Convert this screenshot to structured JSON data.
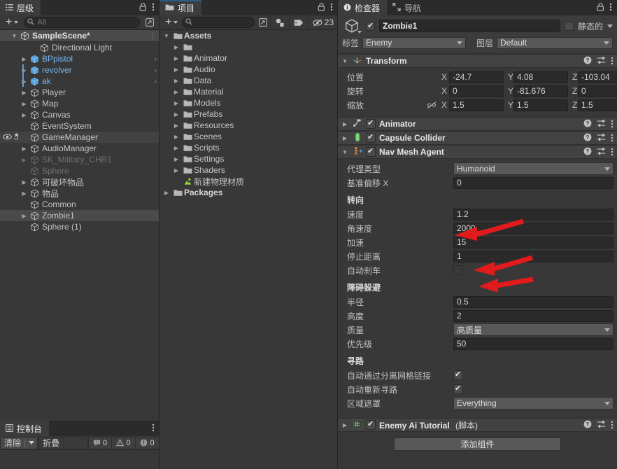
{
  "hierarchy": {
    "tab_label": "层级",
    "tab_icon": "hierarchy-icon",
    "search_placeholder": "All",
    "add_label": "+",
    "items": [
      {
        "label": "SampleScene*",
        "depth": 0,
        "icon": "scene-icon",
        "twisty": "▼",
        "selected": true,
        "kebab": true
      },
      {
        "label": "Directional Light",
        "depth": 2,
        "icon": "gameobject-icon",
        "twisty": ""
      },
      {
        "label": "BPpistol",
        "depth": 1,
        "icon": "prefab-icon",
        "twisty": "▶",
        "prefab": true,
        "chevron": "›"
      },
      {
        "label": "revolver",
        "depth": 1,
        "icon": "prefab-icon",
        "twisty": "▶",
        "prefab": true,
        "chevron": "›",
        "bar": true
      },
      {
        "label": "ak",
        "depth": 1,
        "icon": "prefab-icon",
        "twisty": "▶",
        "prefab": true,
        "chevron": "›",
        "bar": true
      },
      {
        "label": "Player",
        "depth": 1,
        "icon": "gameobject-icon",
        "twisty": "▶"
      },
      {
        "label": "Map",
        "depth": 1,
        "icon": "gameobject-icon",
        "twisty": "▶"
      },
      {
        "label": "Canvas",
        "depth": 1,
        "icon": "gameobject-icon",
        "twisty": "▶"
      },
      {
        "label": "EventSystem",
        "depth": 1,
        "icon": "gameobject-icon",
        "twisty": ""
      },
      {
        "label": "GameManager",
        "depth": 1,
        "icon": "gameobject-icon",
        "twisty": "",
        "hover": true,
        "gutter": true
      },
      {
        "label": "AudioManager",
        "depth": 1,
        "icon": "gameobject-icon",
        "twisty": "▶"
      },
      {
        "label": "SK_Military_CHR1",
        "depth": 1,
        "icon": "gameobject-icon",
        "twisty": "▶",
        "dim": true
      },
      {
        "label": "Sphere",
        "depth": 1,
        "icon": "gameobject-icon",
        "twisty": "",
        "dim": true
      },
      {
        "label": "可破坏物品",
        "depth": 1,
        "icon": "gameobject-icon",
        "twisty": "▶"
      },
      {
        "label": "物品",
        "depth": 1,
        "icon": "gameobject-icon",
        "twisty": "▶"
      },
      {
        "label": "Common",
        "depth": 1,
        "icon": "gameobject-icon",
        "twisty": ""
      },
      {
        "label": "Zombie1",
        "depth": 1,
        "icon": "gameobject-icon",
        "twisty": "▶",
        "selected": true
      },
      {
        "label": "Sphere (1)",
        "depth": 1,
        "icon": "gameobject-icon",
        "twisty": ""
      }
    ]
  },
  "project": {
    "tab_label": "项目",
    "tab_icon": "folder-icon",
    "search_placeholder": "",
    "add_label": "+",
    "badge_count": "23",
    "items": [
      {
        "label": "Assets",
        "depth": 0,
        "twisty": "▼",
        "icon": "folder-open-icon",
        "bold": true
      },
      {
        "label": "",
        "depth": 1,
        "twisty": "▶",
        "icon": "folder-icon"
      },
      {
        "label": "Animator",
        "depth": 1,
        "twisty": "▶",
        "icon": "folder-icon"
      },
      {
        "label": "Audio",
        "depth": 1,
        "twisty": "▶",
        "icon": "folder-icon"
      },
      {
        "label": "Data",
        "depth": 1,
        "twisty": "▶",
        "icon": "folder-icon"
      },
      {
        "label": "Material",
        "depth": 1,
        "twisty": "▶",
        "icon": "folder-icon"
      },
      {
        "label": "Models",
        "depth": 1,
        "twisty": "▶",
        "icon": "folder-icon"
      },
      {
        "label": "Prefabs",
        "depth": 1,
        "twisty": "▶",
        "icon": "folder-icon"
      },
      {
        "label": "Resources",
        "depth": 1,
        "twisty": "▶",
        "icon": "folder-icon"
      },
      {
        "label": "Scenes",
        "depth": 1,
        "twisty": "▶",
        "icon": "folder-icon"
      },
      {
        "label": "Scripts",
        "depth": 1,
        "twisty": "▶",
        "icon": "folder-icon"
      },
      {
        "label": "Settings",
        "depth": 1,
        "twisty": "▶",
        "icon": "folder-icon"
      },
      {
        "label": "Shaders",
        "depth": 1,
        "twisty": "▶",
        "icon": "folder-icon"
      },
      {
        "label": "新建物理材质",
        "depth": 1,
        "twisty": "",
        "icon": "physic-material-icon"
      },
      {
        "label": "Packages",
        "depth": 0,
        "twisty": "▶",
        "icon": "folder-icon",
        "bold": true
      }
    ]
  },
  "inspector": {
    "tabs": [
      {
        "label": "检查器",
        "icon": "info-icon",
        "active": true
      },
      {
        "label": "导航",
        "icon": "navigation-icon",
        "active": false
      }
    ],
    "object": {
      "name": "Zombie1",
      "enabled": true,
      "static_label": "静态的",
      "static_checked": false,
      "tag_label": "标签",
      "tag_value": "Enemy",
      "layer_label": "图层",
      "layer_value": "Default"
    },
    "transform": {
      "title": "Transform",
      "icon": "transform-icon",
      "rows": [
        {
          "name": "位置",
          "x": "-24.7",
          "y": "4.08",
          "z": "-103.04",
          "link": false
        },
        {
          "name": "旋转",
          "x": "0",
          "y": "-81.676",
          "z": "0",
          "link": false
        },
        {
          "name": "缩放",
          "x": "1.5",
          "y": "1.5",
          "z": "1.5",
          "link": true
        }
      ],
      "axis_x": "X",
      "axis_y": "Y",
      "axis_z": "Z"
    },
    "components": [
      {
        "title": "Animator",
        "icon": "animator-icon",
        "enabled": true,
        "expanded": false
      },
      {
        "title": "Capsule Collider",
        "icon": "capsule-collider-icon",
        "enabled": true,
        "expanded": false
      }
    ],
    "navmesh": {
      "title": "Nav Mesh Agent",
      "icon": "navmesh-agent-icon",
      "enabled": true,
      "expanded": true,
      "agent_type_label": "代理类型",
      "agent_type_value": "Humanoid",
      "base_offset_label": "基准偏移 X",
      "base_offset_value": "0",
      "steering_header": "转向",
      "speed_label": "速度",
      "speed_value": "1.2",
      "angular_label": "角速度",
      "angular_value": "2000",
      "accel_label": "加速",
      "accel_value": "15",
      "stopping_label": "停止距离",
      "stopping_value": "1",
      "autobrake_label": "自动刹车",
      "autobrake_checked": false,
      "avoidance_header": "障碍躲避",
      "radius_label": "半径",
      "radius_value": "0.5",
      "height_label": "高度",
      "height_value": "2",
      "quality_label": "质量",
      "quality_value": "高质量",
      "priority_label": "优先级",
      "priority_value": "50",
      "pathfinding_header": "寻路",
      "autotraverse_label": "自动通过分离网格链接",
      "autotraverse_checked": true,
      "autorepath_label": "自动重新寻路",
      "autorepath_checked": true,
      "areamask_label": "区域遮罩",
      "areamask_value": "Everything"
    },
    "script_component": {
      "title": "Enemy Ai Tutorial",
      "suffix": "(脚本)",
      "icon": "script-icon",
      "enabled": true,
      "expanded": false
    },
    "add_component_label": "添加组件"
  },
  "console": {
    "tab_label": "控制台",
    "tab_icon": "console-icon",
    "clear_label": "清除",
    "collapse_label": "折叠",
    "log_count": "0",
    "warning_count": "0",
    "error_count": "0"
  },
  "colors": {
    "panel_bg": "#383838",
    "header_bg": "#2b2b2b",
    "component_header": "#424242",
    "field_bg": "#2a2a2a",
    "dropdown_bg": "#585858",
    "selection": "#4a4a4a",
    "prefab_blue": "#72b6f0",
    "tab_accent": "#2c5d87",
    "annotation_red": "#e11b1b"
  },
  "annotations": [
    {
      "name": "arrow-angular-speed",
      "target": "角速度"
    },
    {
      "name": "arrow-stopping-distance",
      "target": "停止距离"
    },
    {
      "name": "arrow-auto-braking",
      "target": "自动刹车"
    }
  ]
}
